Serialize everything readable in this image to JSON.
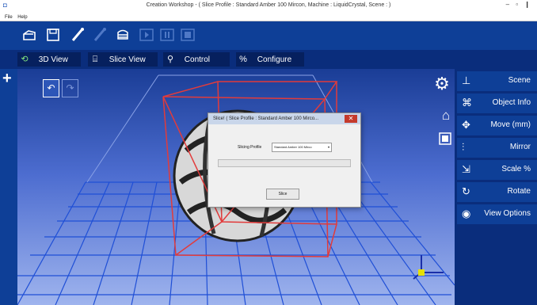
{
  "window": {
    "title": "Creation Workshop -  ( Slice Profile : Standard Amber 100 Mircon, Machine : LiquidCrystal, Scene : )",
    "app_icon": "app-icon",
    "controls": "– ▫ ❙"
  },
  "menu": {
    "file": "File",
    "help": "Help"
  },
  "toolbar": {
    "icons": [
      "open-icon",
      "save-icon",
      "connect-icon",
      "disconnect-icon",
      "slice-icon",
      "play-icon",
      "pause-icon",
      "stop-icon"
    ]
  },
  "tabs": [
    {
      "label": "3D View",
      "icon": "3d-view-icon"
    },
    {
      "label": "Slice View",
      "icon": "slice-view-icon"
    },
    {
      "label": "Control",
      "icon": "control-icon"
    },
    {
      "label": "Configure",
      "icon": "configure-icon"
    }
  ],
  "right_panel": {
    "items": [
      {
        "label": "Scene",
        "icon": "scene-icon"
      },
      {
        "label": "Object Info",
        "icon": "object-info-icon"
      },
      {
        "label": "Move (mm)",
        "icon": "move-icon"
      },
      {
        "label": "Mirror",
        "icon": "mirror-icon"
      },
      {
        "label": "Scale %",
        "icon": "scale-icon"
      },
      {
        "label": "Rotate",
        "icon": "rotate-icon"
      },
      {
        "label": "View Options",
        "icon": "view-options-icon"
      }
    ]
  },
  "dialog": {
    "title": "Slice!  ( Slice Profile : Standard Amber 100 Mirco...",
    "profile_label": "Slicing Profile",
    "profile_value": "Standard Amber 100 Mirco",
    "slice_button": "Slice",
    "progress": 0
  },
  "colors": {
    "toolbar": "#0e3f97",
    "panel": "#0a2d7c",
    "bounding_box": "#e23b3b",
    "grid": "#1f4fd6",
    "dialog_close": "#c43a2c"
  }
}
